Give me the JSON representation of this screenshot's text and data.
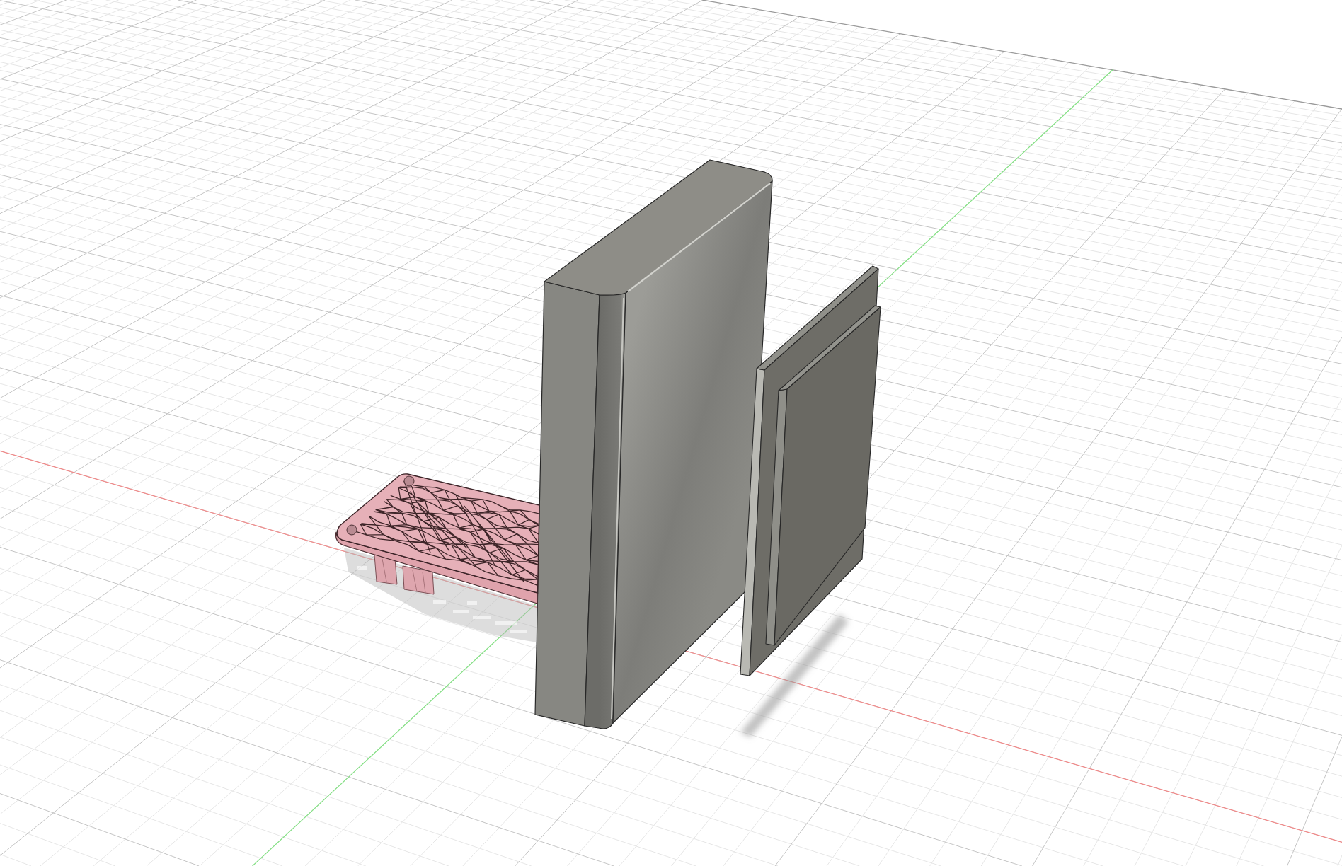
{
  "viewport": {
    "axes": [
      {
        "kind": "x",
        "color": "#f28b8b"
      },
      {
        "kind": "y",
        "color": "#86e386"
      }
    ],
    "bodies": [
      {
        "kind": "mesh"
      },
      {
        "kind": "solid"
      },
      {
        "kind": "plate"
      }
    ]
  }
}
